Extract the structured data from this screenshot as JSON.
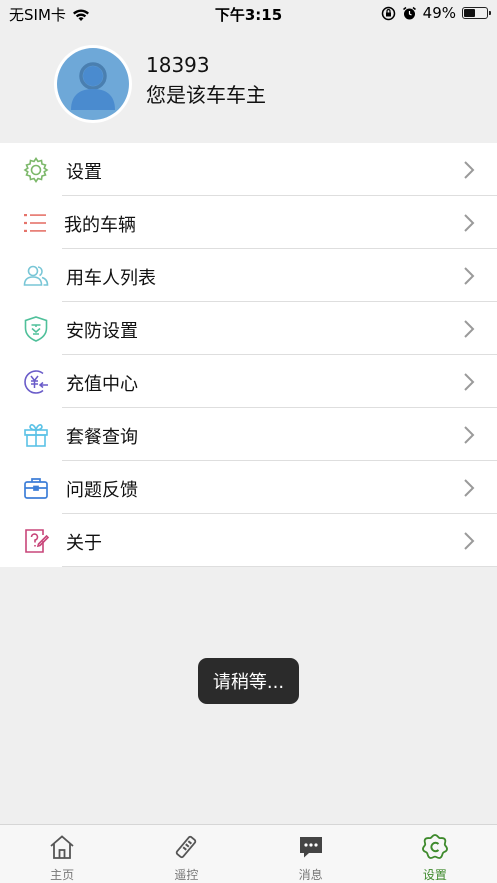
{
  "status_bar": {
    "carrier": "无SIM卡",
    "time": "下午3:15",
    "battery_percent": "49%",
    "battery_level": 0.49
  },
  "profile": {
    "name": "18393",
    "role": "您是该车车主"
  },
  "menu": {
    "items": [
      {
        "label": "设置",
        "icon": "gear-icon"
      },
      {
        "label": "我的车辆",
        "icon": "list-icon"
      },
      {
        "label": "用车人列表",
        "icon": "users-icon"
      },
      {
        "label": "安防设置",
        "icon": "shield-icon"
      },
      {
        "label": "充值中心",
        "icon": "recharge-icon"
      },
      {
        "label": "套餐查询",
        "icon": "gift-icon"
      },
      {
        "label": "问题反馈",
        "icon": "briefcase-icon"
      },
      {
        "label": "关于",
        "icon": "question-doc-icon"
      }
    ]
  },
  "toast": {
    "text": "请稍等..."
  },
  "tab_bar": {
    "tabs": [
      {
        "label": "主页",
        "icon": "home-icon",
        "active": false
      },
      {
        "label": "遥控",
        "icon": "remote-key-icon",
        "active": false
      },
      {
        "label": "消息",
        "icon": "message-icon",
        "active": false
      },
      {
        "label": "设置",
        "icon": "settings-flower-icon",
        "active": true
      }
    ]
  },
  "colors": {
    "accent_green": "#3e8a2c",
    "avatar_blue": "#6ea8d8",
    "background": "#efefef"
  }
}
